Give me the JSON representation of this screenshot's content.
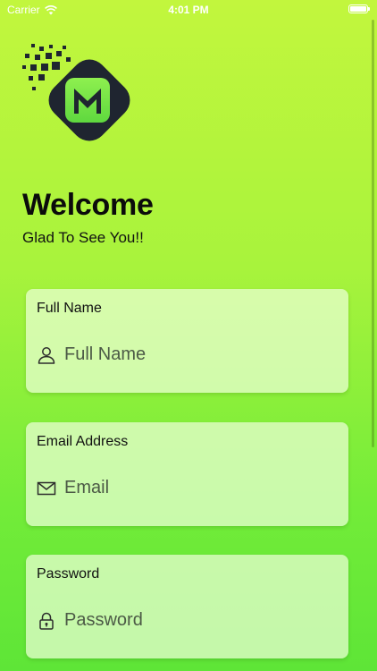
{
  "status_bar": {
    "carrier": "Carrier",
    "time": "4:01 PM",
    "wifi_icon": "wifi-icon",
    "battery_icon": "battery-icon"
  },
  "logo": {
    "letter": "M",
    "colors": {
      "body": "#1f2530",
      "tile": "#7ee94a",
      "pixels": "#1f2530"
    }
  },
  "welcome": {
    "title": "Welcome",
    "subtitle": "Glad To See You!!"
  },
  "fields": [
    {
      "label": "Full Name",
      "placeholder": "Full Name",
      "value": "",
      "icon": "user-icon"
    },
    {
      "label": "Email Address",
      "placeholder": "Email",
      "value": "",
      "icon": "envelope-icon"
    },
    {
      "label": "Password",
      "placeholder": "Password",
      "value": "",
      "icon": "lock-icon"
    }
  ],
  "colors": {
    "background_top": "#c2f63d",
    "background_bottom": "#5ee537",
    "card_background": "#ebffd7",
    "text": "#111111"
  }
}
